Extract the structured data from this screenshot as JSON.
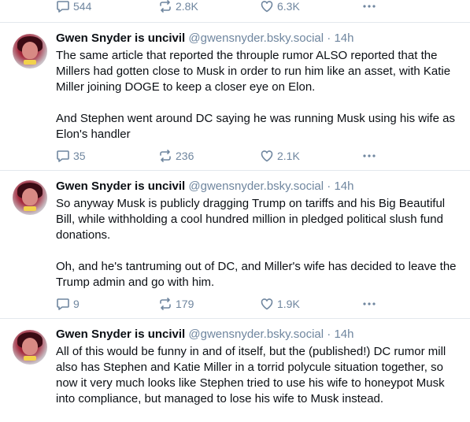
{
  "top_actions": {
    "replies": "544",
    "reposts": "2.8K",
    "likes": "6.3K"
  },
  "posts": [
    {
      "author": "Gwen Snyder is uncivil",
      "handle": "@gwensnyder.bsky.social",
      "time": "14h",
      "paragraphs": [
        "The same article that reported the throuple rumor ALSO reported that the Millers had gotten close to Musk in order to run him like an asset, with Katie Miller joining DOGE to keep a closer eye on Elon.",
        "And Stephen went around DC saying he was running Musk using his wife as Elon's handler"
      ],
      "replies": "35",
      "reposts": "236",
      "likes": "2.1K"
    },
    {
      "author": "Gwen Snyder is uncivil",
      "handle": "@gwensnyder.bsky.social",
      "time": "14h",
      "paragraphs": [
        "So anyway Musk is publicly dragging Trump on tariffs and his Big Beautiful Bill, while withholding a cool hundred million in pledged political slush fund donations.",
        "Oh, and he's tantruming out of DC, and Miller's wife has decided to leave the Trump admin and go with him."
      ],
      "replies": "9",
      "reposts": "179",
      "likes": "1.9K"
    },
    {
      "author": "Gwen Snyder is uncivil",
      "handle": "@gwensnyder.bsky.social",
      "time": "14h",
      "paragraphs": [
        "All of this would be funny in and of itself, but the (published!) DC rumor mill also has Stephen and Katie Miller in a torrid polycule situation together, so now it very much looks like Stephen tried to use his wife to honeypot Musk into compliance, but managed to lose his wife to Musk instead."
      ]
    }
  ],
  "separator": " · "
}
